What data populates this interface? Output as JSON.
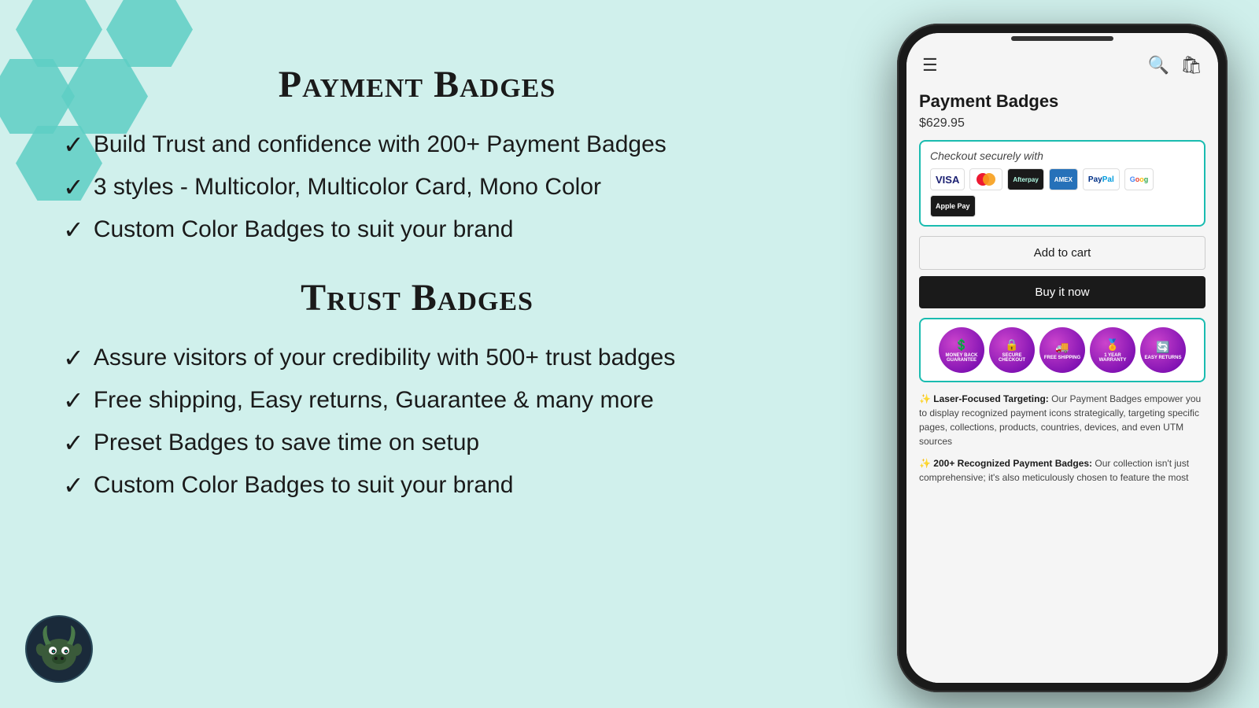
{
  "page": {
    "bg_color": "#d0f0ec"
  },
  "left": {
    "section1": {
      "title": "Payment Badges",
      "features": [
        "Build Trust and confidence with 200+ Payment Badges",
        "3 styles - Multicolor, Multicolor Card, Mono Color",
        "Custom Color Badges to suit your brand"
      ]
    },
    "section2": {
      "title": "Trust Badges",
      "features": [
        "Assure visitors of your credibility with 500+ trust badges",
        "Free shipping, Easy returns, Guarantee & many more",
        "Preset Badges to save time on setup",
        "Custom Color Badges to suit your brand"
      ]
    }
  },
  "phone": {
    "product_title": "Payment Badges",
    "product_price": "$629.95",
    "checkout_label": "Checkout securely with",
    "payment_methods": [
      "VISA",
      "MC",
      "Afterpay",
      "AMEX",
      "PayPal",
      "GPay",
      "Apple Pay"
    ],
    "add_to_cart_label": "Add to cart",
    "buy_now_label": "Buy it now",
    "trust_badges": [
      {
        "label": "MONEY BACK GUARANTEE",
        "icon": "$"
      },
      {
        "label": "SECURE CHECKOUT",
        "icon": "🔒"
      },
      {
        "label": "FREE SHIPPING",
        "icon": "🚚"
      },
      {
        "label": "1 YEAR WARRANTY",
        "icon": "🏅"
      },
      {
        "label": "EASY RETURNS",
        "icon": "🔄"
      }
    ],
    "description_blocks": [
      {
        "prefix": "✨",
        "bold": "Laser-Focused Targeting:",
        "text": " Our Payment Badges empower you to display recognized payment icons strategically, targeting specific pages, collections, products, countries, devices, and even UTM sources"
      },
      {
        "prefix": "✨",
        "bold": "200+ Recognized Payment Badges:",
        "text": " Our collection isn't just comprehensive; it's also meticulously chosen to feature the most"
      }
    ]
  }
}
